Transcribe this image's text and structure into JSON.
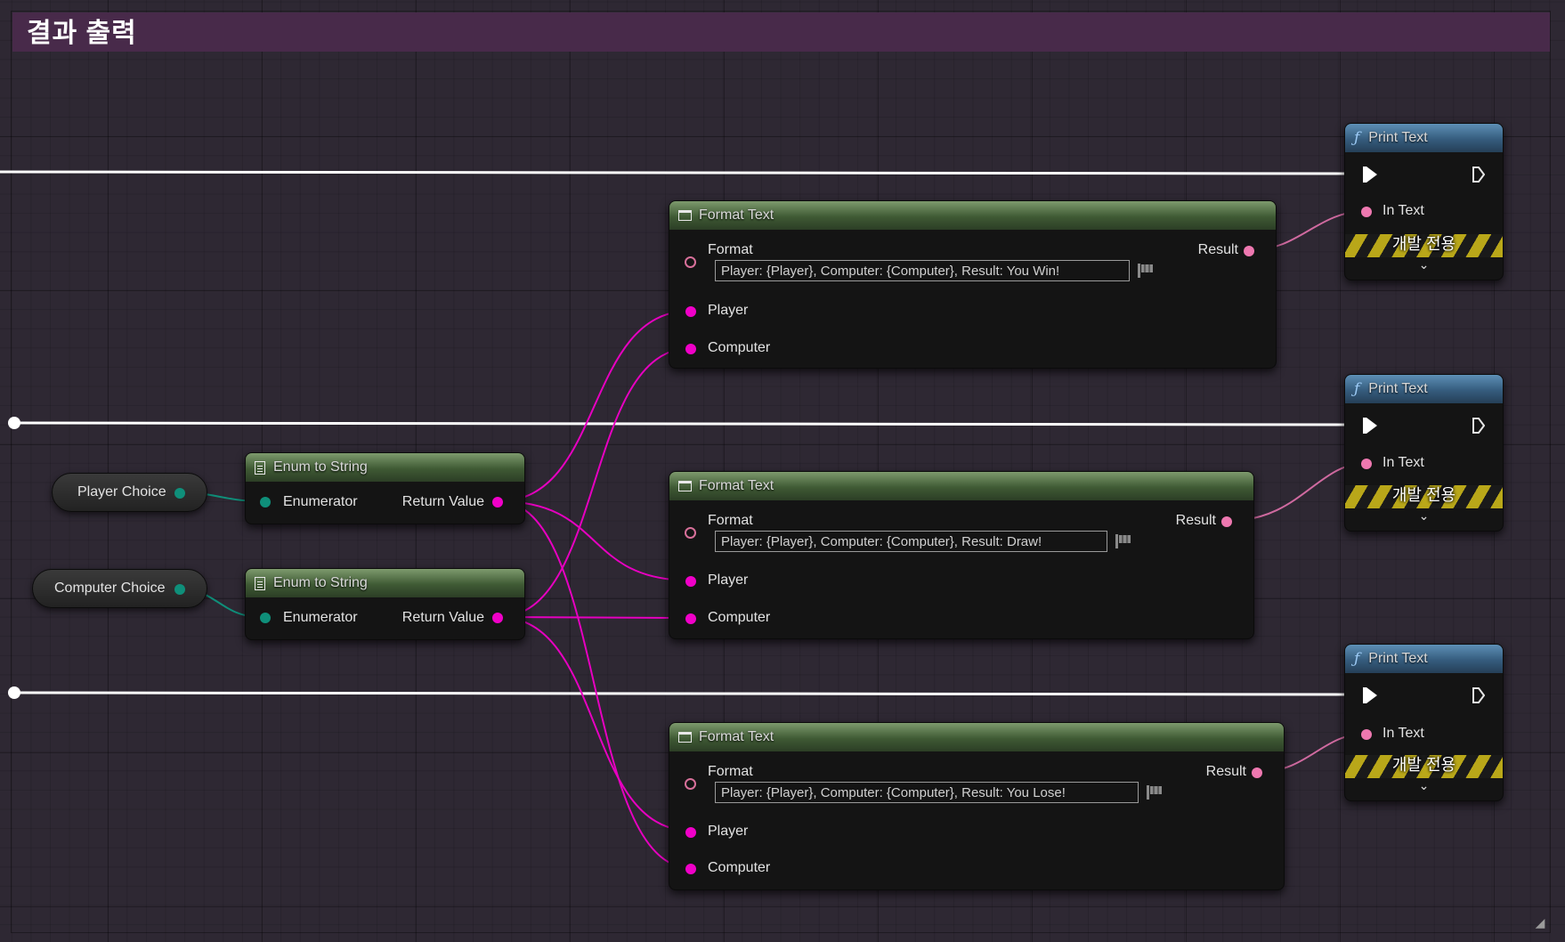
{
  "comment": {
    "title": "결과 출력"
  },
  "enum_nodes": [
    {
      "title": "Enum to String",
      "input": "Enumerator",
      "output": "Return Value"
    },
    {
      "title": "Enum to String",
      "input": "Enumerator",
      "output": "Return Value"
    }
  ],
  "variables": [
    {
      "label": "Player Choice"
    },
    {
      "label": "Computer Choice"
    }
  ],
  "format_nodes": [
    {
      "title": "Format Text",
      "format_label": "Format",
      "format_value": "Player: {Player}, Computer: {Computer}, Result: You Win!",
      "pin_player": "Player",
      "pin_computer": "Computer",
      "result_label": "Result"
    },
    {
      "title": "Format Text",
      "format_label": "Format",
      "format_value": "Player: {Player}, Computer: {Computer}, Result: Draw!",
      "pin_player": "Player",
      "pin_computer": "Computer",
      "result_label": "Result"
    },
    {
      "title": "Format Text",
      "format_label": "Format",
      "format_value": "Player: {Player}, Computer: {Computer}, Result: You Lose!",
      "pin_player": "Player",
      "pin_computer": "Computer",
      "result_label": "Result"
    }
  ],
  "print_nodes": [
    {
      "title": "Print Text",
      "in_text_label": "In Text",
      "dev_label": "개발 전용"
    },
    {
      "title": "Print Text",
      "in_text_label": "In Text",
      "dev_label": "개발 전용"
    },
    {
      "title": "Print Text",
      "in_text_label": "In Text",
      "dev_label": "개발 전용"
    }
  ],
  "colors": {
    "string_pin": "#f000c8",
    "text_pin": "#ee78b0",
    "enum_pin": "#0f8f7a",
    "exec_wire": "#ffffff",
    "comment_header": "#482a4a"
  },
  "icons": {
    "function": "function-f-icon",
    "enum": "document-icon",
    "format": "window-icon",
    "flag": "flag-icon",
    "expand": "chevron-down-icon",
    "resize": "resize-grip-icon"
  }
}
